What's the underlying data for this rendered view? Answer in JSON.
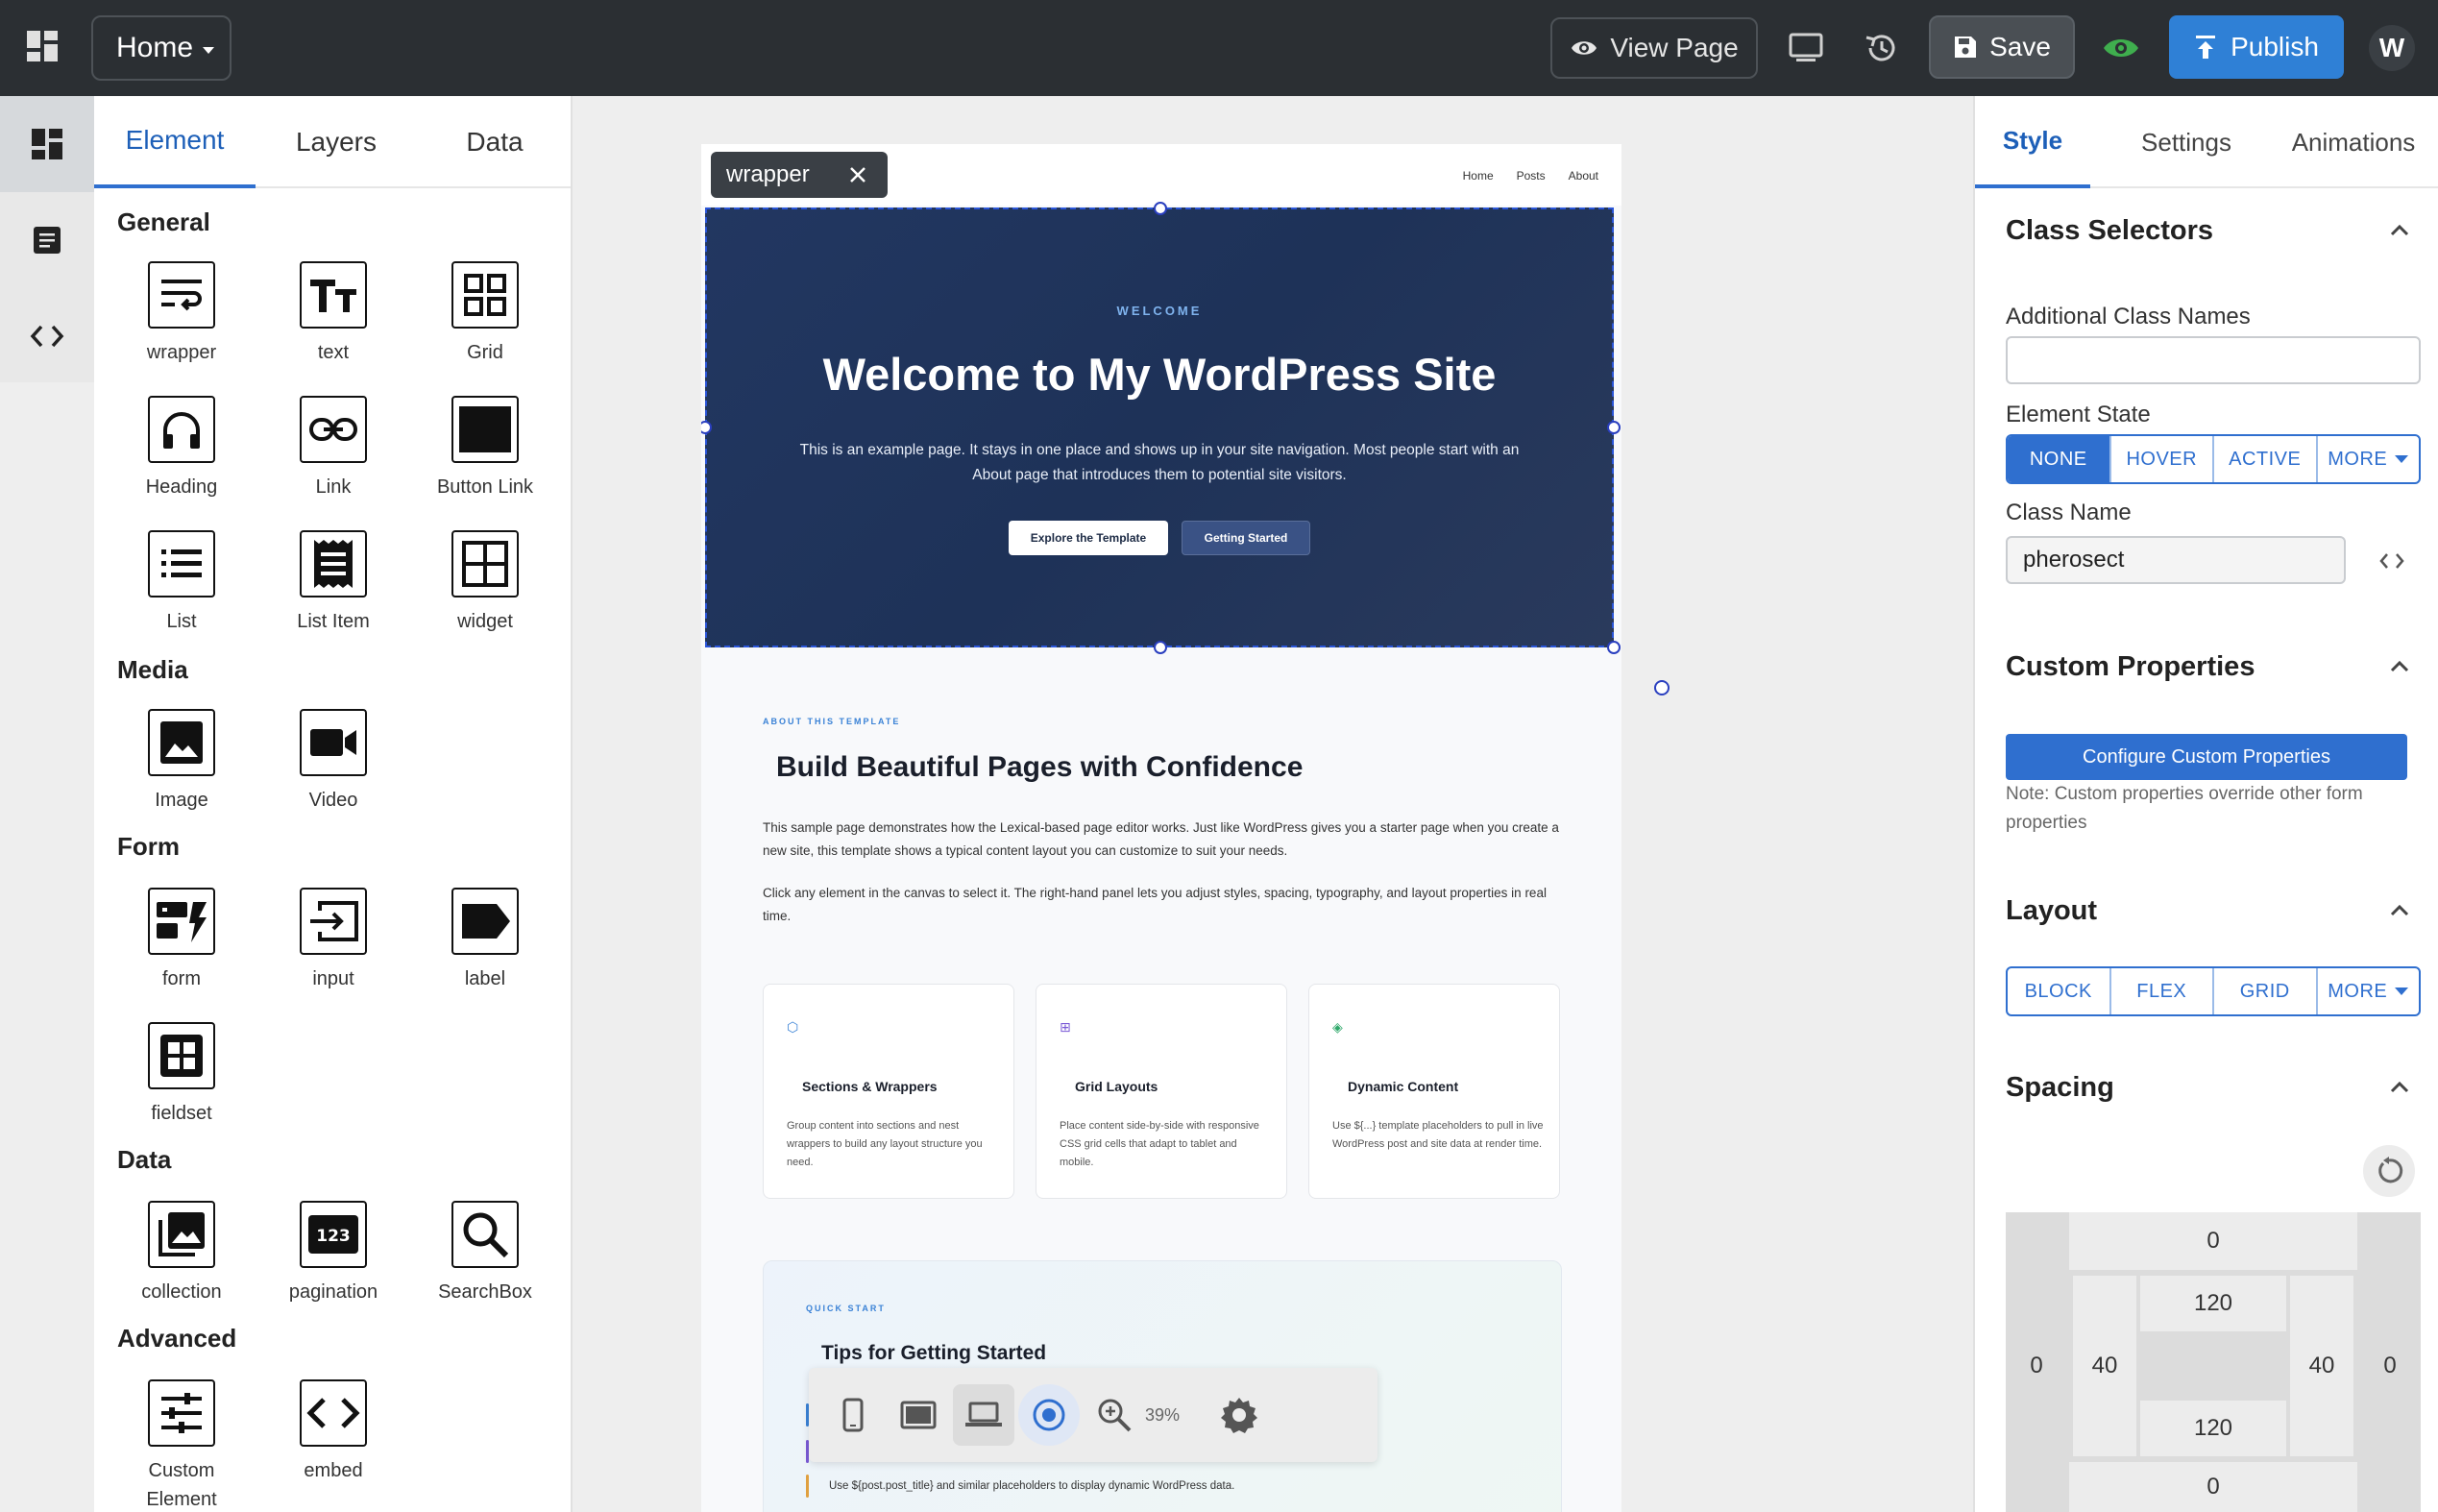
{
  "topbar": {
    "home_label": "Home",
    "view_page_label": "View Page",
    "save_label": "Save",
    "publish_label": "Publish",
    "avatar_initial": "W"
  },
  "left_panel": {
    "tabs": [
      "Element",
      "Layers",
      "Data"
    ],
    "sections": {
      "general": {
        "title": "General",
        "items": [
          "wrapper",
          "text",
          "Grid",
          "Heading",
          "Link",
          "Button Link",
          "List",
          "List Item",
          "widget"
        ]
      },
      "media": {
        "title": "Media",
        "items": [
          "Image",
          "Video"
        ]
      },
      "form": {
        "title": "Form",
        "items": [
          "form",
          "input",
          "label",
          "fieldset"
        ]
      },
      "data": {
        "title": "Data",
        "items": [
          "collection",
          "pagination",
          "SearchBox"
        ]
      },
      "advanced": {
        "title": "Advanced",
        "items": [
          "Custom Element",
          "embed"
        ]
      }
    }
  },
  "canvas": {
    "selected_tag": "wrapper",
    "nav_links": [
      "Home",
      "Posts",
      "About"
    ],
    "hero": {
      "eyebrow": "WELCOME",
      "title": "Welcome to My WordPress Site",
      "text": "This is an example page. It stays in one place and shows up in your site navigation. Most people start with an About page that introduces them to potential site visitors.",
      "btn_primary": "Explore the Template",
      "btn_secondary": "Getting Started"
    },
    "about": {
      "eyebrow": "ABOUT THIS TEMPLATE",
      "title": "Build Beautiful Pages with Confidence",
      "p1": "This sample page demonstrates how the Lexical-based page editor works. Just like WordPress gives you a starter page when you create a new site, this template shows a typical content layout you can customize to suit your needs.",
      "p2": "Click any element in the canvas to select it. The right-hand panel lets you adjust styles, spacing, typography, and layout properties in real time."
    },
    "cards": [
      {
        "icon": "⬡",
        "title": "Sections & Wrappers",
        "text": "Group content into sections and nest wrappers to build any layout structure you need."
      },
      {
        "icon": "⊞",
        "title": "Grid Layouts",
        "text": "Place content side-by-side with responsive CSS grid cells that adapt to tablet and mobile."
      },
      {
        "icon": "◈",
        "title": "Dynamic Content",
        "text": "Use ${...} template placeholders to pull in live WordPress post and site data at render time."
      }
    ],
    "quick": {
      "eyebrow": "QUICK START",
      "title": "Tips for Getting Started",
      "line": "Use ${post.post_title} and similar placeholders to display dynamic WordPress data."
    },
    "zoom_label": "39%"
  },
  "right_panel": {
    "tabs": [
      "Style",
      "Settings",
      "Animations"
    ],
    "class_selectors": {
      "title": "Class Selectors",
      "additional_label": "Additional Class Names",
      "additional_value": "",
      "state_label": "Element State",
      "states": [
        "NONE",
        "HOVER",
        "ACTIVE",
        "MORE"
      ],
      "active_state": "NONE",
      "class_name_label": "Class Name",
      "class_name_value": "pherosect"
    },
    "custom_properties": {
      "title": "Custom Properties",
      "button": "Configure Custom Properties",
      "note": "Note: Custom properties override other form properties"
    },
    "layout": {
      "title": "Layout",
      "options": [
        "BLOCK",
        "FLEX",
        "GRID",
        "MORE"
      ]
    },
    "spacing": {
      "title": "Spacing",
      "margin_top": "0",
      "margin_left": "0",
      "margin_right": "0",
      "margin_bottom": "0",
      "padding_top": "120",
      "padding_left": "40",
      "padding_right": "40",
      "padding_bottom": "120"
    }
  },
  "colors": {
    "topbar_bg": "#2b2f33",
    "accent": "#2f6fcf",
    "publish": "#2f80d6",
    "hero_bg": "#223761",
    "preview_eye": "#3fae4e"
  }
}
